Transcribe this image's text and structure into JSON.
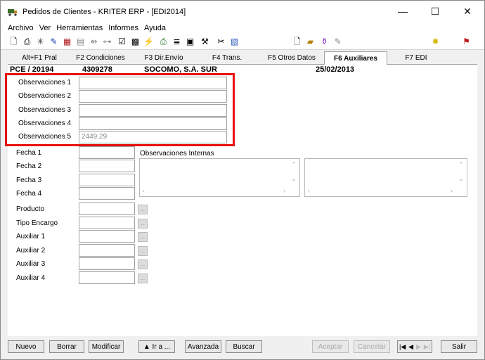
{
  "window": {
    "title": "Pedidos de Clientes - KRITER ERP - [EDI2014]",
    "minimize": "—",
    "maximize": "☐",
    "close": "✕"
  },
  "menu": [
    "Archivo",
    "Ver",
    "Herramientas",
    "Informes",
    "Ayuda"
  ],
  "toolbar_icons": [
    "preview-icon",
    "print-icon",
    "spark-icon",
    "edit-icon",
    "calculator-icon",
    "document-icon",
    "split-icon",
    "tree-icon",
    "sheet-icon",
    "grid-icon",
    "link-icon",
    "printer-icon",
    "list-icon",
    "form-icon",
    "tools-icon",
    "cut-icon",
    "paste-icon",
    "page-icon",
    "folder-icon",
    "bottle-icon",
    "clip-icon",
    "bulb-icon",
    "exit-icon"
  ],
  "tabs": [
    {
      "label": "Alt+F1 Pral",
      "active": false
    },
    {
      "label": "F2 Condiciones",
      "active": false
    },
    {
      "label": "F3 Dir.Envío",
      "active": false
    },
    {
      "label": "F4 Trans.",
      "active": false
    },
    {
      "label": "F5 Otros Datos",
      "active": false
    },
    {
      "label": "F6 Auxiliares",
      "active": true
    },
    {
      "label": "F7 EDI",
      "active": false
    }
  ],
  "info": {
    "order": "PCE / 20194",
    "code": "4309278",
    "customer": "SOCOMO, S.A. SUR",
    "date": "25/02/2013"
  },
  "observaciones": [
    {
      "label": "Observaciones 1",
      "value": ""
    },
    {
      "label": "Observaciones 2",
      "value": ""
    },
    {
      "label": "Observaciones 3",
      "value": ""
    },
    {
      "label": "Observaciones 4",
      "value": ""
    },
    {
      "label": "Observaciones 5",
      "value": "2449.29"
    }
  ],
  "fechas": [
    {
      "label": "Fecha 1",
      "value": ""
    },
    {
      "label": "Fecha 2",
      "value": ""
    },
    {
      "label": "Fecha 3",
      "value": ""
    },
    {
      "label": "Fecha 4",
      "value": ""
    }
  ],
  "observaciones_internas_label": "Observaciones Internas",
  "lookups": [
    {
      "label": "Producto",
      "value": ""
    },
    {
      "label": "Tipo Encargo",
      "value": ""
    },
    {
      "label": "Auxiliar 1",
      "value": ""
    },
    {
      "label": "Auxiliar 2",
      "value": ""
    },
    {
      "label": "Auxiliar 3",
      "value": ""
    },
    {
      "label": "Auxiliar 4",
      "value": ""
    }
  ],
  "lookup_button_label": "...",
  "buttons": {
    "nuevo": "Nuevo",
    "borrar": "Borrar",
    "modificar": "Modificar",
    "ira": "▲ Ir a ...",
    "avanzada": "Avanzada",
    "buscar": "Buscar",
    "aceptar": "Aceptar",
    "cancelar": "Cancelar",
    "salir": "Salir"
  },
  "nav": {
    "first": "|◀",
    "prev": "◀",
    "next": "▶",
    "last": "▶|"
  },
  "highlight_color": "#e81010"
}
